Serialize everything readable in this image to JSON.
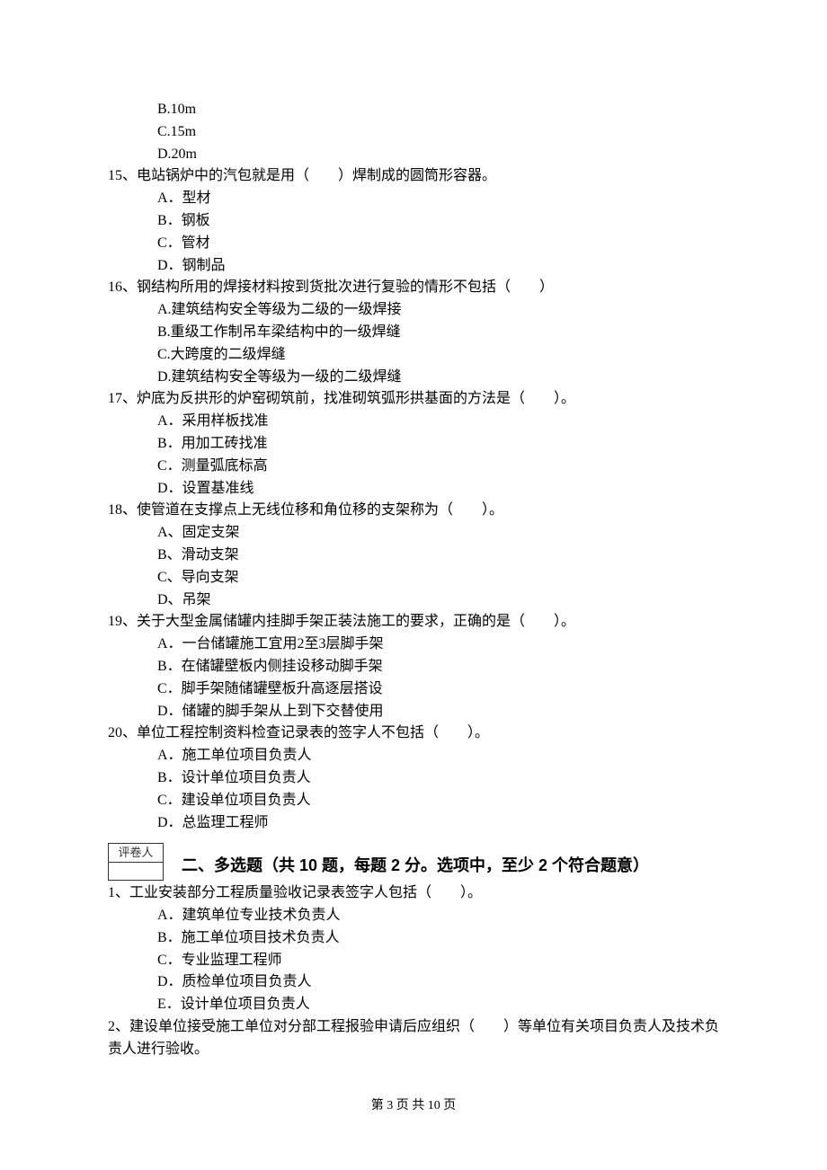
{
  "top_options": {
    "b": "B.10m",
    "c": "C.15m",
    "d": "D.20m"
  },
  "q15": {
    "stem": "15、电站锅炉中的汽包就是用（　　）焊制成的圆筒形容器。",
    "a": "A．型材",
    "b": "B．钢板",
    "c": "C．管材",
    "d": "D．钢制品"
  },
  "q16": {
    "stem": "16、钢结构所用的焊接材料按到货批次进行复验的情形不包括（　　）",
    "a": "A.建筑结构安全等级为二级的一级焊接",
    "b": "B.重级工作制吊车梁结构中的一级焊缝",
    "c": "C.大跨度的二级焊缝",
    "d": "D.建筑结构安全等级为一级的二级焊缝"
  },
  "q17": {
    "stem": "17、炉底为反拱形的炉窑砌筑前，找准砌筑弧形拱基面的方法是（　　）。",
    "a": "A．采用样板找准",
    "b": "B．用加工砖找准",
    "c": "C．测量弧底标高",
    "d": "D．设置基准线"
  },
  "q18": {
    "stem": "18、使管道在支撑点上无线位移和角位移的支架称为（　　）。",
    "a": "A、固定支架",
    "b": "B、滑动支架",
    "c": "C、导向支架",
    "d": "D、吊架"
  },
  "q19": {
    "stem": "19、关于大型金属储罐内挂脚手架正装法施工的要求，正确的是（　　）。",
    "a": "A．一台储罐施工宜用2至3层脚手架",
    "b": "B．在储罐壁板内侧挂设移动脚手架",
    "c": "C．脚手架随储罐壁板升高逐层搭设",
    "d": "D．储罐的脚手架从上到下交替使用"
  },
  "q20": {
    "stem": "20、单位工程控制资料检查记录表的签字人不包括（　　）。",
    "a": "A．施工单位项目负责人",
    "b": "B．设计单位项目负责人",
    "c": "C．建设单位项目负责人",
    "d": "D．总监理工程师"
  },
  "grader_label": "评卷人",
  "section2_title": "二、多选题（共 10 题，每题 2 分。选项中，至少 2 个符合题意）",
  "mq1": {
    "stem": "1、工业安装部分工程质量验收记录表签字人包括（　　）。",
    "a": "A．建筑单位专业技术负责人",
    "b": "B．施工单位项目技术负责人",
    "c": "C．专业监理工程师",
    "d": "D．质检单位项目负责人",
    "e": "E．设计单位项目负责人"
  },
  "mq2": {
    "stem": "2、建设单位接受施工单位对分部工程报验申请后应组织（　　）等单位有关项目负责人及技术负责人进行验收。"
  },
  "footer": "第 3 页 共 10 页"
}
